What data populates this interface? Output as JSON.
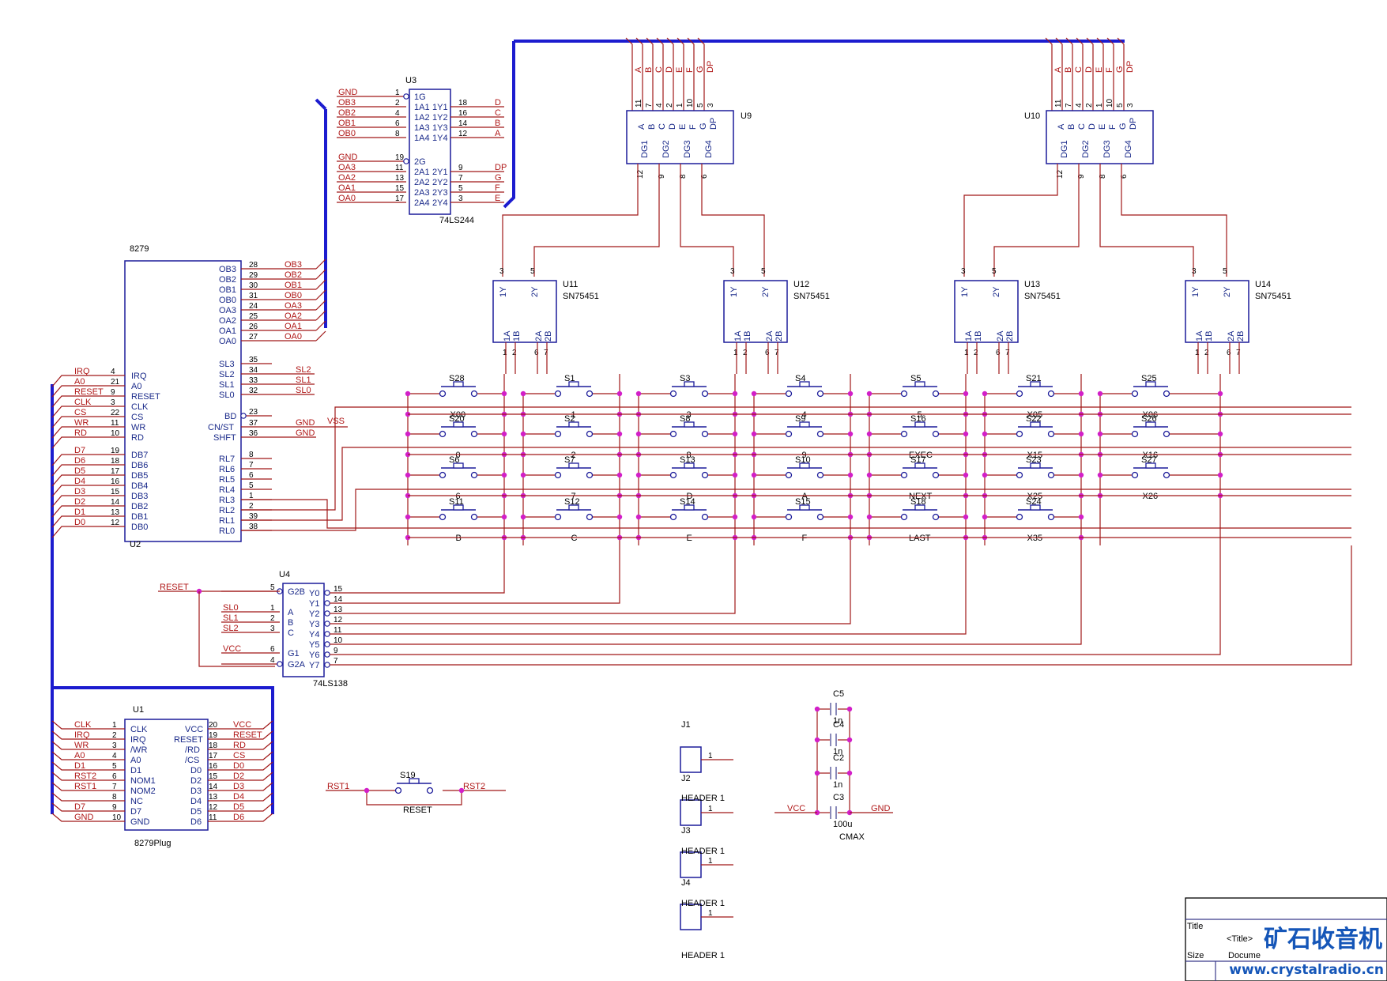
{
  "u3": {
    "ref": "U3",
    "part": "74LS244",
    "left": [
      {
        "net": "GND",
        "pin": "1",
        "name": "1G"
      },
      {
        "net": "OB3",
        "pin": "2",
        "name": "1A1"
      },
      {
        "net": "OB2",
        "pin": "4",
        "name": "1A2"
      },
      {
        "net": "OB1",
        "pin": "6",
        "name": "1A3"
      },
      {
        "net": "OB0",
        "pin": "8",
        "name": "1A4"
      },
      {
        "net": "GND",
        "pin": "19",
        "name": "2G"
      },
      {
        "net": "OA3",
        "pin": "11",
        "name": "2A1"
      },
      {
        "net": "OA2",
        "pin": "13",
        "name": "2A2"
      },
      {
        "net": "OA1",
        "pin": "15",
        "name": "2A3"
      },
      {
        "net": "OA0",
        "pin": "17",
        "name": "2A4"
      }
    ],
    "right": [
      {
        "net": "D",
        "pin": "18",
        "name": "1Y1"
      },
      {
        "net": "C",
        "pin": "16",
        "name": "1Y2"
      },
      {
        "net": "B",
        "pin": "14",
        "name": "1Y3"
      },
      {
        "net": "A",
        "pin": "12",
        "name": "1Y4"
      },
      {
        "net": "DP",
        "pin": "9",
        "name": "2Y1"
      },
      {
        "net": "G",
        "pin": "7",
        "name": "2Y2"
      },
      {
        "net": "F",
        "pin": "5",
        "name": "2Y3"
      },
      {
        "net": "E",
        "pin": "3",
        "name": "2Y4"
      }
    ]
  },
  "u2": {
    "ref": "U2",
    "part": "8279",
    "left": [
      {
        "net": "IRQ",
        "pin": "4",
        "name": "IRQ"
      },
      {
        "net": "A0",
        "pin": "21",
        "name": "A0"
      },
      {
        "net": "RESET",
        "pin": "9",
        "name": "RESET"
      },
      {
        "net": "CLK",
        "pin": "3",
        "name": "CLK"
      },
      {
        "net": "CS",
        "pin": "22",
        "name": "CS"
      },
      {
        "net": "WR",
        "pin": "11",
        "name": "WR"
      },
      {
        "net": "RD",
        "pin": "10",
        "name": "RD"
      },
      {
        "net": "D7",
        "pin": "19",
        "name": "DB7"
      },
      {
        "net": "D6",
        "pin": "18",
        "name": "DB6"
      },
      {
        "net": "D5",
        "pin": "17",
        "name": "DB5"
      },
      {
        "net": "D4",
        "pin": "16",
        "name": "DB4"
      },
      {
        "net": "D3",
        "pin": "15",
        "name": "DB3"
      },
      {
        "net": "D2",
        "pin": "14",
        "name": "DB2"
      },
      {
        "net": "D1",
        "pin": "13",
        "name": "DB1"
      },
      {
        "net": "D0",
        "pin": "12",
        "name": "DB0"
      }
    ],
    "right": [
      {
        "name": "OB3",
        "pin": "28",
        "net": "OB3"
      },
      {
        "name": "OB2",
        "pin": "29",
        "net": "OB2"
      },
      {
        "name": "OB1",
        "pin": "30",
        "net": "OB1"
      },
      {
        "name": "OB0",
        "pin": "31",
        "net": "OB0"
      },
      {
        "name": "OA3",
        "pin": "24",
        "net": "OA3"
      },
      {
        "name": "OA2",
        "pin": "25",
        "net": "OA2"
      },
      {
        "name": "OA1",
        "pin": "26",
        "net": "OA1"
      },
      {
        "name": "OA0",
        "pin": "27",
        "net": "OA0"
      },
      {
        "name": "SL3",
        "pin": "35",
        "net": ""
      },
      {
        "name": "SL2",
        "pin": "34",
        "net": "SL2"
      },
      {
        "name": "SL1",
        "pin": "33",
        "net": "SL1"
      },
      {
        "name": "SL0",
        "pin": "32",
        "net": "SL0"
      },
      {
        "name": "BD",
        "pin": "23",
        "net": ""
      },
      {
        "name": "CN/ST",
        "pin": "37",
        "net": "GND"
      },
      {
        "name": "SHFT",
        "pin": "36",
        "net": "GND"
      },
      {
        "name": "RL7",
        "pin": "8",
        "net": ""
      },
      {
        "name": "RL6",
        "pin": "7",
        "net": ""
      },
      {
        "name": "RL5",
        "pin": "6",
        "net": ""
      },
      {
        "name": "RL4",
        "pin": "5",
        "net": ""
      },
      {
        "name": "RL3",
        "pin": "1",
        "net": ""
      },
      {
        "name": "RL2",
        "pin": "2",
        "net": ""
      },
      {
        "name": "RL1",
        "pin": "39",
        "net": ""
      },
      {
        "name": "RL0",
        "pin": "38",
        "net": ""
      }
    ],
    "vss": "VSS"
  },
  "seg_chips": [
    {
      "ref": "U9",
      "seg_labels": [
        "A",
        "B",
        "C",
        "D",
        "E",
        "F",
        "G",
        "DP"
      ],
      "seg_pins": [
        "11",
        "7",
        "4",
        "2",
        "1",
        "10",
        "5",
        "3"
      ],
      "dg_labels": [
        "DG1",
        "DG2",
        "DG3",
        "DG4"
      ],
      "dg_pins": [
        "12",
        "9",
        "8",
        "6"
      ]
    },
    {
      "ref": "U10",
      "seg_labels": [
        "A",
        "B",
        "C",
        "D",
        "E",
        "F",
        "G",
        "DP"
      ],
      "seg_pins": [
        "11",
        "7",
        "4",
        "2",
        "1",
        "10",
        "5",
        "3"
      ],
      "dg_labels": [
        "DG1",
        "DG2",
        "DG3",
        "DG4"
      ],
      "dg_pins": [
        "12",
        "9",
        "8",
        "6"
      ]
    }
  ],
  "drivers": [
    {
      "ref": "U11",
      "part": "SN75451"
    },
    {
      "ref": "U12",
      "part": "SN75451"
    },
    {
      "ref": "U13",
      "part": "SN75451"
    },
    {
      "ref": "U14",
      "part": "SN75451"
    }
  ],
  "driver_pins": {
    "top": [
      "1Y",
      "2Y"
    ],
    "top_nums": [
      "3",
      "5"
    ],
    "bot": [
      "1A",
      "1B",
      "2A",
      "2B"
    ],
    "bot_nums": [
      "1",
      "2",
      "6",
      "7"
    ]
  },
  "keys": [
    [
      {
        "ref": "S28",
        "label": "X00"
      },
      {
        "ref": "S1",
        "label": "1"
      },
      {
        "ref": "S3",
        "label": "3"
      },
      {
        "ref": "S4",
        "label": "4"
      },
      {
        "ref": "S5",
        "label": "5"
      },
      {
        "ref": "S21",
        "label": "X05"
      },
      {
        "ref": "S25",
        "label": "X06"
      }
    ],
    [
      {
        "ref": "S20",
        "label": "0"
      },
      {
        "ref": "S2",
        "label": "2"
      },
      {
        "ref": "S8",
        "label": "8"
      },
      {
        "ref": "S9",
        "label": "9"
      },
      {
        "ref": "S16",
        "label": "EXEC"
      },
      {
        "ref": "S22",
        "label": "X15"
      },
      {
        "ref": "S26",
        "label": "X16"
      }
    ],
    [
      {
        "ref": "S6",
        "label": "6"
      },
      {
        "ref": "S7",
        "label": "7"
      },
      {
        "ref": "S13",
        "label": "D"
      },
      {
        "ref": "S10",
        "label": "A"
      },
      {
        "ref": "S17",
        "label": "NEXT"
      },
      {
        "ref": "S23",
        "label": "X25"
      },
      {
        "ref": "S27",
        "label": "X26"
      }
    ],
    [
      {
        "ref": "S11",
        "label": "B"
      },
      {
        "ref": "S12",
        "label": "C"
      },
      {
        "ref": "S14",
        "label": "E"
      },
      {
        "ref": "S15",
        "label": "F"
      },
      {
        "ref": "S18",
        "label": "LAST"
      },
      {
        "ref": "S24",
        "label": "X35"
      },
      null
    ]
  ],
  "u4": {
    "ref": "U4",
    "part": "74LS138",
    "reset_net": "RESET",
    "vcc_net": "VCC",
    "left": [
      {
        "net": "RESET",
        "pin": "5",
        "name": "G2B"
      },
      {
        "net": "SL0",
        "pin": "1",
        "name": "A"
      },
      {
        "net": "SL1",
        "pin": "2",
        "name": "B"
      },
      {
        "net": "SL2",
        "pin": "3",
        "name": "C"
      },
      {
        "net": "VCC",
        "pin": "6",
        "name": "G1"
      },
      {
        "net": "",
        "pin": "4",
        "name": "G2A"
      }
    ],
    "right": [
      {
        "name": "Y0",
        "pin": "15"
      },
      {
        "name": "Y1",
        "pin": "14"
      },
      {
        "name": "Y2",
        "pin": "13"
      },
      {
        "name": "Y3",
        "pin": "12"
      },
      {
        "name": "Y4",
        "pin": "11"
      },
      {
        "name": "Y5",
        "pin": "10"
      },
      {
        "name": "Y6",
        "pin": "9"
      },
      {
        "name": "Y7",
        "pin": "7"
      }
    ]
  },
  "u1": {
    "ref": "U1",
    "part": "8279Plug",
    "left": [
      {
        "net": "CLK",
        "pin": "1",
        "name": "CLK"
      },
      {
        "net": "IRQ",
        "pin": "2",
        "name": "IRQ"
      },
      {
        "net": "WR",
        "pin": "3",
        "name": "/WR"
      },
      {
        "net": "A0",
        "pin": "4",
        "name": "A0"
      },
      {
        "net": "D1",
        "pin": "5",
        "name": "D1"
      },
      {
        "net": "RST2",
        "pin": "6",
        "name": "NOM1"
      },
      {
        "net": "RST1",
        "pin": "7",
        "name": "NOM2"
      },
      {
        "net": "",
        "pin": "8",
        "name": "NC"
      },
      {
        "net": "D7",
        "pin": "9",
        "name": "D7"
      },
      {
        "net": "GND",
        "pin": "10",
        "name": "GND"
      }
    ],
    "right": [
      {
        "net": "VCC",
        "pin": "20",
        "name": "VCC"
      },
      {
        "net": "RESET",
        "pin": "19",
        "name": "RESET"
      },
      {
        "net": "RD",
        "pin": "18",
        "name": "/RD"
      },
      {
        "net": "CS",
        "pin": "17",
        "name": "/CS"
      },
      {
        "net": "D0",
        "pin": "16",
        "name": "D0"
      },
      {
        "net": "D2",
        "pin": "15",
        "name": "D2"
      },
      {
        "net": "D3",
        "pin": "14",
        "name": "D3"
      },
      {
        "net": "D4",
        "pin": "13",
        "name": "D4"
      },
      {
        "net": "D5",
        "pin": "12",
        "name": "D5"
      },
      {
        "net": "D6",
        "pin": "11",
        "name": "D6"
      }
    ]
  },
  "s19": {
    "ref": "S19",
    "label": "RESET",
    "left_net": "RST1",
    "right_net": "RST2"
  },
  "headers": [
    {
      "ref": "J1",
      "pin": "1",
      "label": "HEADER 1"
    },
    {
      "ref": "J2",
      "pin": "1",
      "label": "HEADER 1"
    },
    {
      "ref": "J3",
      "pin": "1",
      "label": "HEADER 1"
    },
    {
      "ref": "J4",
      "pin": "1",
      "label": "HEADER 1"
    }
  ],
  "caps": [
    {
      "ref": "C5",
      "value": "1n"
    },
    {
      "ref": "C4",
      "value": "1n"
    },
    {
      "ref": "C2",
      "value": "1n"
    },
    {
      "ref": "C3",
      "value": "100u"
    }
  ],
  "cap_group": {
    "label": "CMAX",
    "left_net": "VCC",
    "right_net": "GND"
  },
  "title_block": {
    "title_label": "Title",
    "title_value": "<Title>",
    "size_label": "Size",
    "doc_label": "Docume"
  },
  "watermark": {
    "cn": "矿石收音机",
    "url": "www.crystalradio.cn"
  },
  "colors": {
    "bus": "#1c1ccf",
    "wire": "#a01818",
    "junction": "#d21fc8",
    "chip": "#1c1c9a"
  }
}
